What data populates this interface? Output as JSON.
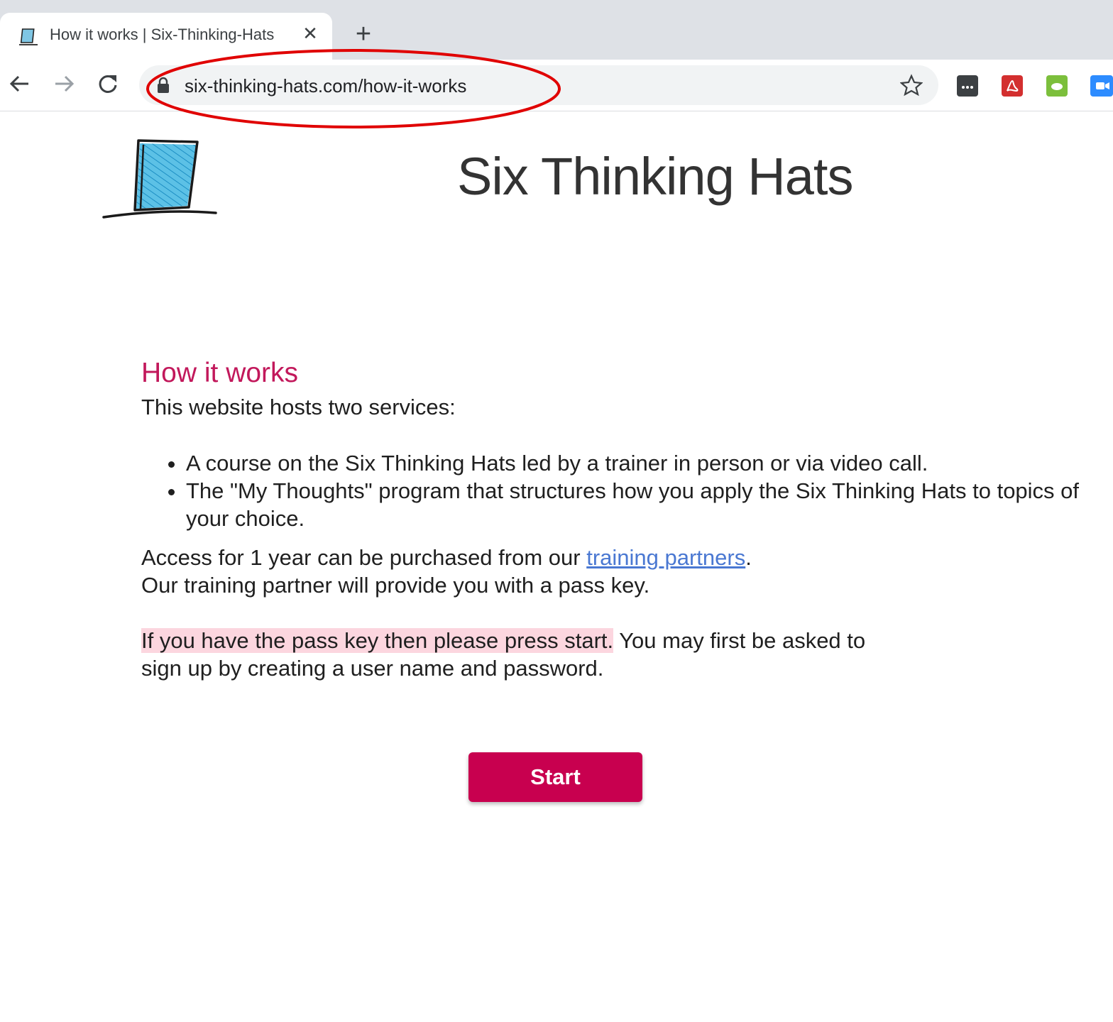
{
  "browser": {
    "tab_title": "How it works | Six-Thinking-Hats",
    "tab_close_glyph": "✕",
    "new_tab_glyph": "+",
    "url": "six-thinking-hats.com/how-it-works"
  },
  "header": {
    "title": "Six Thinking Hats"
  },
  "main": {
    "heading": "How it works",
    "intro": "This website hosts two services:",
    "services": [
      "A course on the Six Thinking Hats led by a trainer in person or via video call.",
      "The \"My Thoughts\" program that structures how you apply the Six Thinking Hats to topics of your choice."
    ],
    "access_prefix": "Access for 1 year can be purchased from our ",
    "access_link": "training partners",
    "access_suffix": ".",
    "partner_note": "Our training partner will provide you with a pass key.",
    "passkey_highlight": "If you have the pass key then please press start.",
    "passkey_rest": " You may first be asked to sign up by creating a user name and password.",
    "start_label": "Start"
  },
  "colors": {
    "accent": "#c8004f",
    "heading": "#c2185b",
    "link": "#4a78d2",
    "highlight": "#fcd6df",
    "annotation": "#e00000"
  },
  "icons": {
    "back": "arrow-left-icon",
    "forward": "arrow-right-icon",
    "reload": "reload-icon",
    "lock": "lock-icon",
    "bookmark": "star-icon",
    "favicon": "hat-logo-icon"
  }
}
